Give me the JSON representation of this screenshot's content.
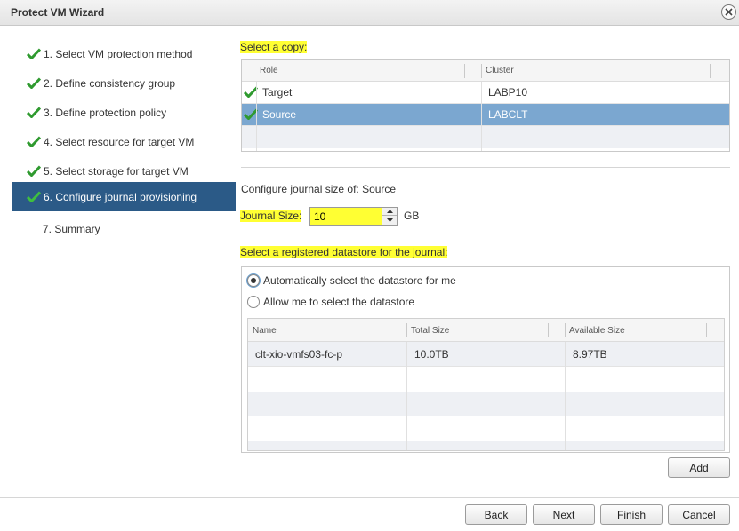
{
  "window": {
    "title": "Protect VM Wizard"
  },
  "steps": [
    {
      "label": "1. Select VM protection method",
      "done": true,
      "active": false
    },
    {
      "label": "2. Define consistency group",
      "done": true,
      "active": false
    },
    {
      "label": "3. Define protection policy",
      "done": true,
      "active": false
    },
    {
      "label": "4. Select resource for target VM",
      "done": true,
      "active": false
    },
    {
      "label": "5. Select storage for target VM",
      "done": true,
      "active": false
    },
    {
      "label": "6. Configure journal provisioning",
      "done": true,
      "active": true
    },
    {
      "label": "7. Summary",
      "done": false,
      "active": false
    }
  ],
  "copy_section": {
    "label": "Select a copy:",
    "columns": [
      "Role",
      "Cluster"
    ],
    "rows": [
      {
        "role": "Target",
        "cluster": "LABP10",
        "selected": false
      },
      {
        "role": "Source",
        "cluster": "LABCLT",
        "selected": true
      }
    ]
  },
  "journal": {
    "configure_label": "Configure journal size of: Source",
    "size_label": "Journal Size:",
    "size_value": "10",
    "unit": "GB"
  },
  "datastore": {
    "label": "Select a registered datastore for the journal:",
    "options": [
      {
        "label": "Automatically select the datastore for me",
        "selected": true
      },
      {
        "label": "Allow me to select the datastore",
        "selected": false
      }
    ],
    "columns": [
      "Name",
      "Total Size",
      "Available Size"
    ],
    "rows": [
      {
        "name": "clt-xio-vmfs03-fc-p",
        "total": "10.0TB",
        "available": "8.97TB"
      }
    ],
    "add_label": "Add"
  },
  "footer": {
    "back": "Back",
    "next": "Next",
    "finish": "Finish",
    "cancel": "Cancel"
  },
  "colors": {
    "active_step": "#2b5a87",
    "selected_row": "#7ba7d0",
    "highlight": "#ffff33",
    "check": "#2f9a2f"
  }
}
